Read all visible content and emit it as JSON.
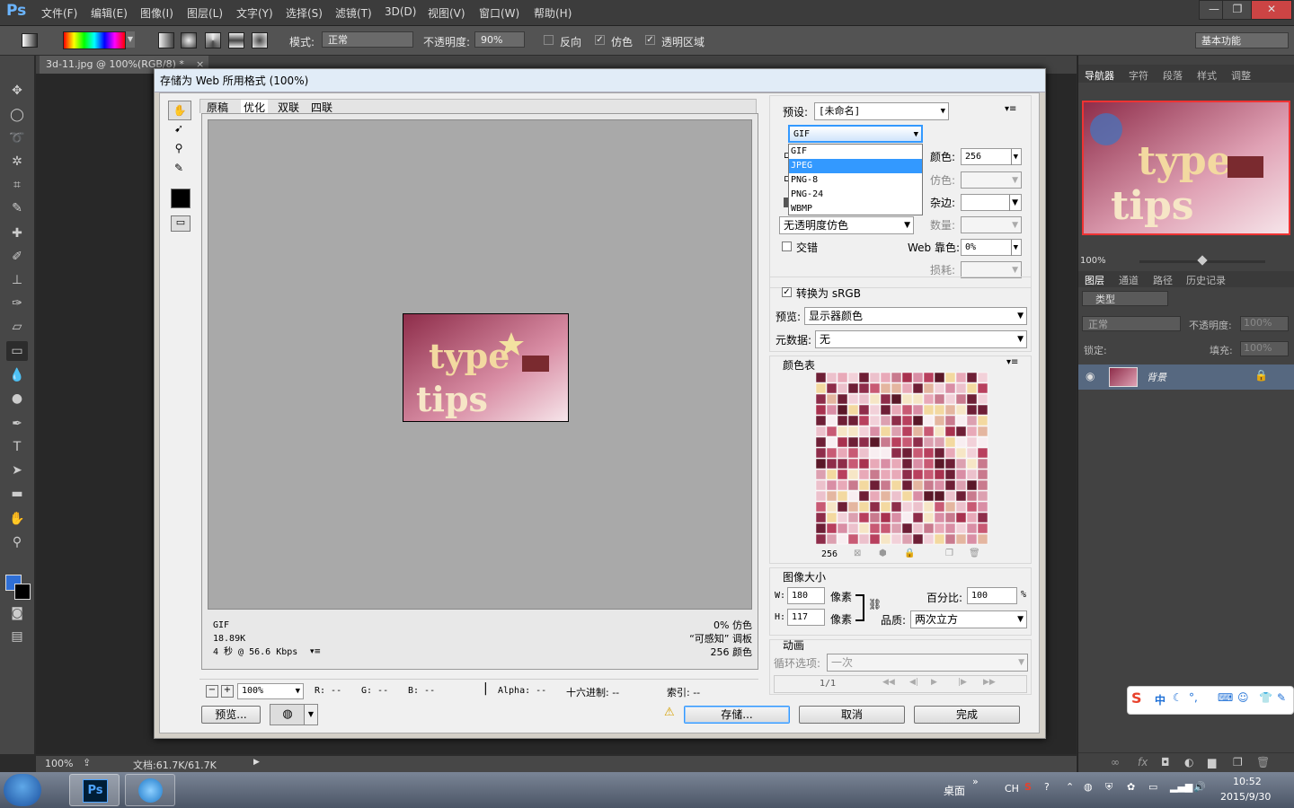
{
  "app": {
    "logo": "Ps",
    "menu": [
      "文件(F)",
      "编辑(E)",
      "图像(I)",
      "图层(L)",
      "文字(Y)",
      "选择(S)",
      "滤镜(T)",
      "3D(D)",
      "视图(V)",
      "窗口(W)",
      "帮助(H)"
    ],
    "window_buttons": [
      "—",
      "❐",
      "✕"
    ]
  },
  "options_bar": {
    "mode_label": "模式:",
    "mode_value": "正常",
    "opacity_label": "不透明度:",
    "opacity_value": "90%",
    "reverse_label": "反向",
    "dither_label": "仿色",
    "transparency_label": "透明区域",
    "workspace": "基本功能"
  },
  "document": {
    "tab": "3d-11.jpg @ 100%(RGB/8) *",
    "tab_close": "×",
    "zoom": "100%",
    "doc_info": "文档:61.7K/61.7K"
  },
  "right_panel": {
    "top_tabs": [
      "导航器",
      "字符",
      "段落",
      "样式",
      "调整"
    ],
    "nav_zoom": "100%",
    "layer_tabs": [
      "图层",
      "通道",
      "路径",
      "历史记录"
    ],
    "filter_kind": "类型",
    "blend_mode": "正常",
    "opacity_label": "不透明度:",
    "opacity_value": "100%",
    "lock_label": "锁定:",
    "fill_label": "填充:",
    "fill_value": "100%",
    "layer_name": "背景"
  },
  "dialog": {
    "title": "存储为 Web 所用格式 (100%)",
    "view_tabs": [
      "原稿",
      "优化",
      "双联",
      "四联"
    ],
    "info": {
      "format": "GIF",
      "size": "18.89K",
      "speed": "4 秒 @ 56.6 Kbps",
      "dither": "0% 仿色",
      "palette": "“可感知” 调板",
      "colors": "256 颜色"
    },
    "bottom": {
      "zoom": "100%",
      "r": "R: --",
      "g": "G: --",
      "b": "B: --",
      "alpha": "Alpha: --",
      "hex": "十六进制: --",
      "index": "索引: --"
    },
    "buttons": {
      "preview": "预览...",
      "save": "存储...",
      "cancel": "取消",
      "done": "完成"
    },
    "settings": {
      "preset_label": "预设:",
      "preset_value": "[未命名]",
      "format_value": "GIF",
      "format_options": [
        "GIF",
        "JPEG",
        "PNG-8",
        "PNG-24",
        "WBMP"
      ],
      "format_selected": "JPEG",
      "colors_label": "颜色:",
      "colors_value": "256",
      "dither_label": "仿色:",
      "matte_label": "杂边:",
      "amount_label": "数量:",
      "transparency_dither": "无透明度仿色",
      "interlaced_label": "交错",
      "web_snap_label": "Web 靠色:",
      "web_snap_value": "0%",
      "lossy_label": "损耗:",
      "convert_srgb": "转换为 sRGB",
      "preview_label": "预览:",
      "preview_value": "显示器颜色",
      "metadata_label": "元数据:",
      "metadata_value": "无",
      "color_table_label": "颜色表",
      "color_count": "256",
      "image_size_label": "图像大小",
      "w_label": "W:",
      "w_value": "180",
      "h_label": "H:",
      "h_value": "117",
      "px_unit": "像素",
      "percent_label": "百分比:",
      "percent_value": "100",
      "percent_unit": "%",
      "quality_label": "品质:",
      "quality_value": "两次立方",
      "animation_label": "动画",
      "loop_label": "循环选项:",
      "loop_value": "一次",
      "frame_counter": "1/1"
    }
  },
  "taskbar": {
    "desktop": "桌面",
    "lang": "CH",
    "time": "10:52",
    "date": "2015/9/30"
  },
  "ime": {
    "label": "中"
  },
  "colors": {
    "ps_accent": "#6bb5ff",
    "selection_blue": "#3399ff",
    "dialog_bg": "#f0f0f0"
  }
}
